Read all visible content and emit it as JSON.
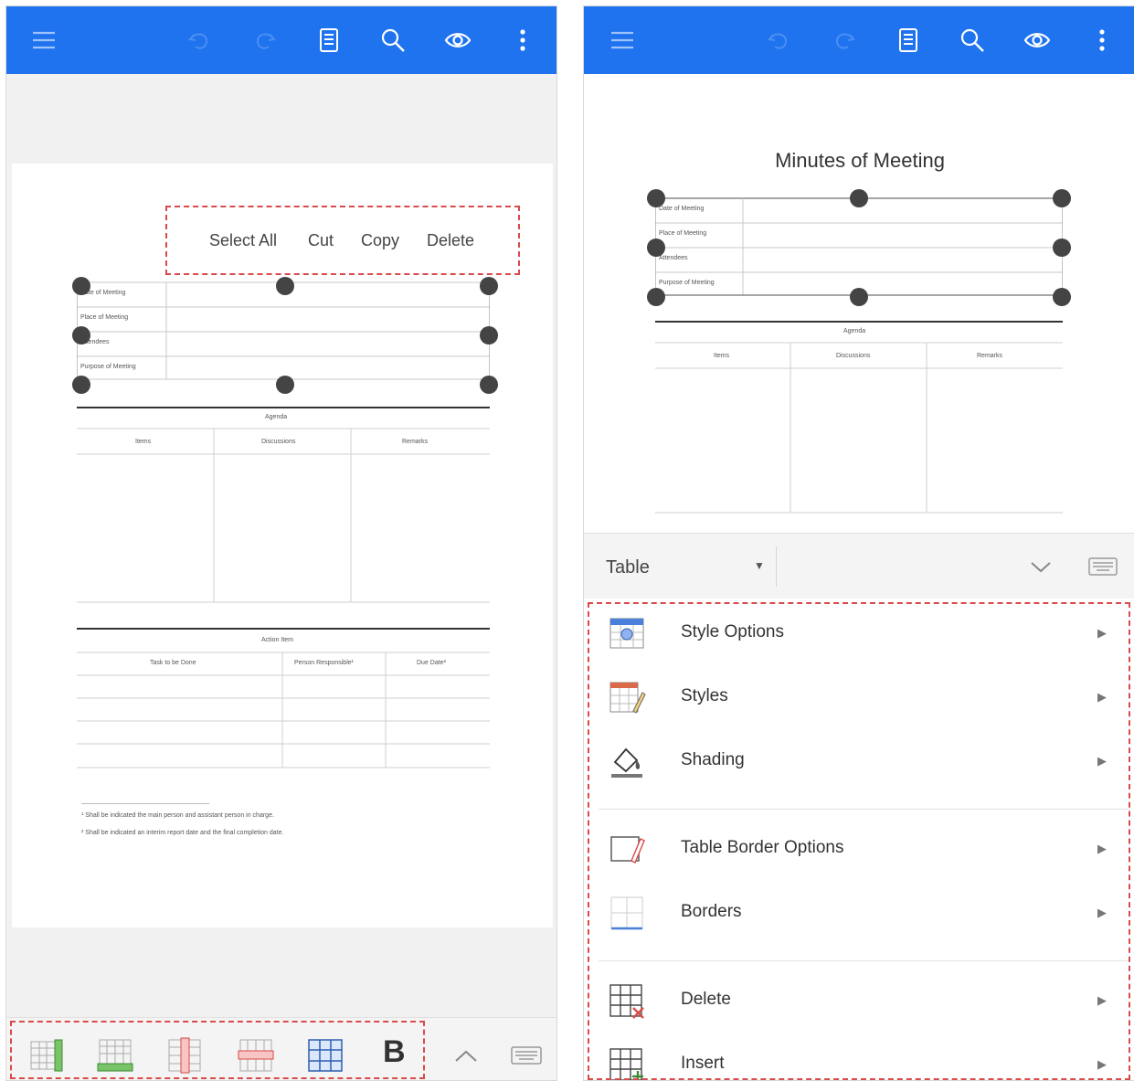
{
  "left": {
    "context_menu": [
      "Select All",
      "Cut",
      "Copy",
      "Delete"
    ],
    "table1_rows": [
      "Date of Meeting",
      "Place of Meeting",
      "Attendees",
      "Purpose of Meeting"
    ],
    "agenda": {
      "title": "Agenda",
      "columns": [
        "Items",
        "Discussions",
        "Remarks"
      ]
    },
    "action": {
      "title": "Action Item",
      "columns": [
        "Task to be Done",
        "Person Responsible¹",
        "Due Date²"
      ]
    },
    "footnotes": [
      "¹ Shall be indicated the main person and assistant person in charge.",
      "² Shall be indicated an interim report date and the final completion date."
    ],
    "bold_label": "B"
  },
  "right": {
    "doc_title": "Minutes of Meeting",
    "table1_rows": [
      "Date of Meeting",
      "Place of Meeting",
      "Attendees",
      "Purpose of Meeting"
    ],
    "agenda": {
      "title": "Agenda",
      "columns": [
        "Items",
        "Discussions",
        "Remarks"
      ]
    },
    "panel_title": "Table",
    "menu": [
      {
        "label": "Style Options",
        "icon": "style-options-icon"
      },
      {
        "label": "Styles",
        "icon": "styles-icon"
      },
      {
        "label": "Shading",
        "icon": "shading-icon"
      },
      {
        "label": "Table Border Options",
        "icon": "table-border-options-icon"
      },
      {
        "label": "Borders",
        "icon": "borders-icon"
      },
      {
        "label": "Delete",
        "icon": "table-delete-icon"
      },
      {
        "label": "Insert",
        "icon": "table-insert-icon"
      }
    ]
  },
  "colors": {
    "toolbar": "#1f73ef",
    "highlight": "#d94a4a"
  }
}
